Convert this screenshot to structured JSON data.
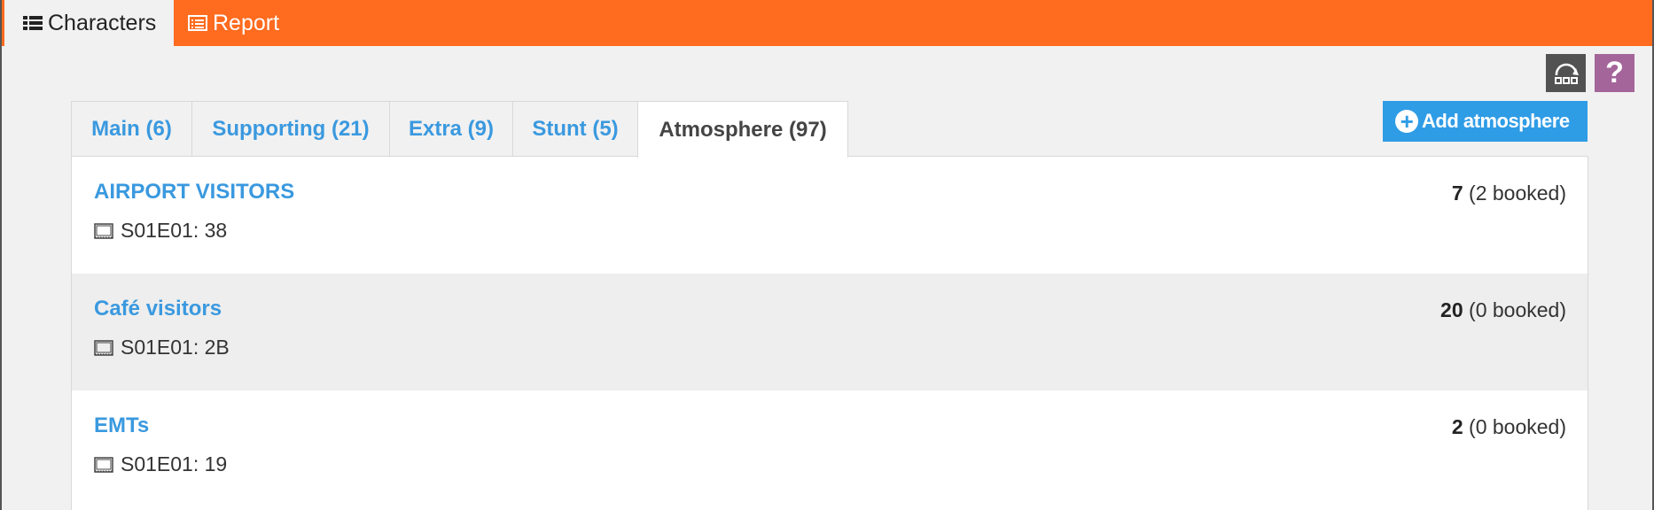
{
  "top_tabs": [
    {
      "label": "Characters",
      "icon": "list-icon"
    },
    {
      "label": "Report",
      "icon": "report-icon"
    }
  ],
  "toolbar": {
    "help_label": "?",
    "add_label": "Add atmosphere",
    "add_icon": "plus-circle-icon"
  },
  "tabs": [
    {
      "label": "Main (6)"
    },
    {
      "label": "Supporting (21)"
    },
    {
      "label": "Extra (9)"
    },
    {
      "label": "Stunt (5)"
    },
    {
      "label": "Atmosphere (97)"
    }
  ],
  "rows": [
    {
      "name": "AIRPORT VISITORS",
      "scene": "S01E01: 38",
      "count": "7",
      "booked": "(2 booked)"
    },
    {
      "name": "Café visitors",
      "scene": "S01E01: 2B",
      "count": "20",
      "booked": "(0 booked)"
    },
    {
      "name": "EMTs",
      "scene": "S01E01: 19",
      "count": "2",
      "booked": "(0 booked)"
    }
  ],
  "colors": {
    "accent_orange": "#ff6b1f",
    "link_blue": "#3a99df",
    "button_blue": "#2f9ce6",
    "help_purple": "#a4659a"
  }
}
